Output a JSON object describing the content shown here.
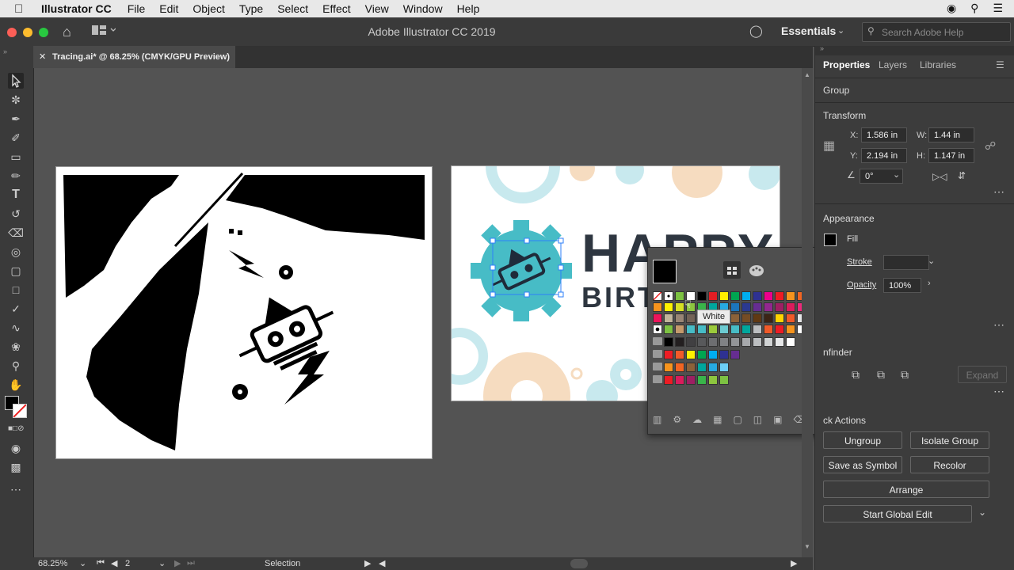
{
  "menubar": {
    "app_name": "Illustrator CC",
    "items": [
      "File",
      "Edit",
      "Object",
      "Type",
      "Select",
      "Effect",
      "View",
      "Window",
      "Help"
    ]
  },
  "appbar": {
    "title": "Adobe Illustrator CC 2019",
    "workspace": "Essentials",
    "search_placeholder": "Search Adobe Help"
  },
  "document": {
    "tab_title": "Tracing.ai* @ 68.25% (CMYK/GPU Preview)"
  },
  "artboard2": {
    "line1": "HAPPY",
    "line2": "BIRT"
  },
  "swatch_popup": {
    "tooltip": "White"
  },
  "status": {
    "zoom": "68.25%",
    "artboard_number": "2",
    "tool": "Selection"
  },
  "panel": {
    "tabs": [
      "Properties",
      "Layers",
      "Libraries"
    ],
    "object_type": "Group",
    "transform": {
      "title": "Transform",
      "x_label": "X:",
      "x": "1.586 in",
      "y_label": "Y:",
      "y": "2.194 in",
      "w_label": "W:",
      "w": "1.44 in",
      "h_label": "H:",
      "h": "1.147 in",
      "angle": "0°"
    },
    "appearance": {
      "title": "Appearance",
      "fill_label": "Fill",
      "stroke_label": "Stroke",
      "opacity_label": "Opacity",
      "opacity": "100%"
    },
    "pathfinder": {
      "title": "nfinder",
      "expand": "Expand"
    },
    "quick_actions": {
      "title": "ck Actions",
      "ungroup": "Ungroup",
      "isolate_group": "Isolate Group",
      "save_as_symbol": "Save as Symbol",
      "recolor": "Recolor",
      "arrange": "Arrange",
      "start_global_edit": "Start Global Edit"
    }
  },
  "colors": {
    "accent_teal": "#47bcc6",
    "navy": "#1f2b3a",
    "selection_blue": "#2d7ff9"
  }
}
